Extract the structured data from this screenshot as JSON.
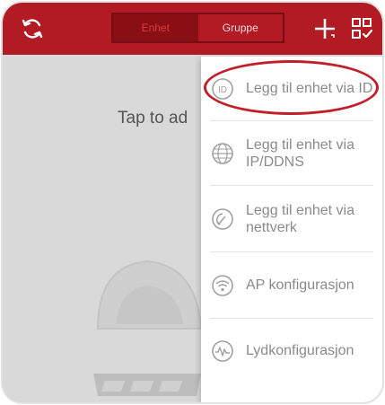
{
  "header": {
    "tabs": [
      {
        "label": "Enhet",
        "active": true
      },
      {
        "label": "Gruppe",
        "active": false
      }
    ],
    "icons": {
      "refresh": "refresh-icon",
      "add": "plus-icon",
      "qr": "qr-scan-icon"
    }
  },
  "main": {
    "hint": "Tap to ad"
  },
  "menu": {
    "items": [
      {
        "label": "Legg til enhet via ID",
        "icon": "id-icon"
      },
      {
        "label": "Legg til enhet via IP/DDNS",
        "icon": "globe-ip-icon"
      },
      {
        "label": "Legg til enhet via nettverk",
        "icon": "network-icon"
      },
      {
        "label": "AP konfigurasjon",
        "icon": "wifi-icon"
      },
      {
        "label": "Lydkonfigurasjon",
        "icon": "sound-wave-icon"
      }
    ],
    "highlighted_index": 0
  },
  "colors": {
    "brand": "#b31b24",
    "highlight": "#c0202a"
  }
}
